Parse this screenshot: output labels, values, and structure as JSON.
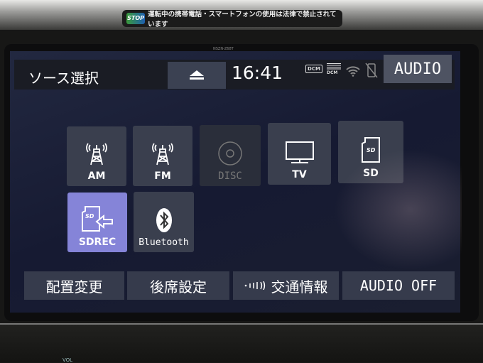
{
  "bezel": {
    "sticker_logo": "STOP",
    "sticker_text": "運転中の携帯電話・スマートフォンの使用は法律で禁止されています",
    "model": "NSZN-Z68T",
    "vol_label": "VOL"
  },
  "header": {
    "title": "ソース選択",
    "time": "16:41",
    "eject_icon": "eject-icon",
    "status_icons": {
      "dcm1": "DCM",
      "dcm2": "DCM"
    },
    "audio_button": "AUDIO"
  },
  "sources": [
    {
      "label": "AM",
      "icon": "radio-tower-icon",
      "state": "normal"
    },
    {
      "label": "FM",
      "icon": "radio-tower-icon",
      "state": "normal"
    },
    {
      "label": "DISC",
      "icon": "disc-icon",
      "state": "disabled"
    },
    {
      "label": "TV",
      "icon": "tv-icon",
      "state": "normal"
    },
    {
      "label": "SD",
      "icon": "sd-card-icon",
      "state": "normal"
    },
    {
      "label": "SDREC",
      "icon": "sd-record-icon",
      "state": "selected"
    },
    {
      "label": "Bluetooth",
      "icon": "bluetooth-icon",
      "state": "normal"
    }
  ],
  "footer": {
    "rearrange": "配置変更",
    "rear_settings": "後席設定",
    "traffic_info": "交通情報",
    "audio_off": "AUDIO OFF"
  },
  "colors": {
    "selected_tile": "#8584d8",
    "tile": "#3a3f4e",
    "screen_bg": "#1a1e36"
  }
}
